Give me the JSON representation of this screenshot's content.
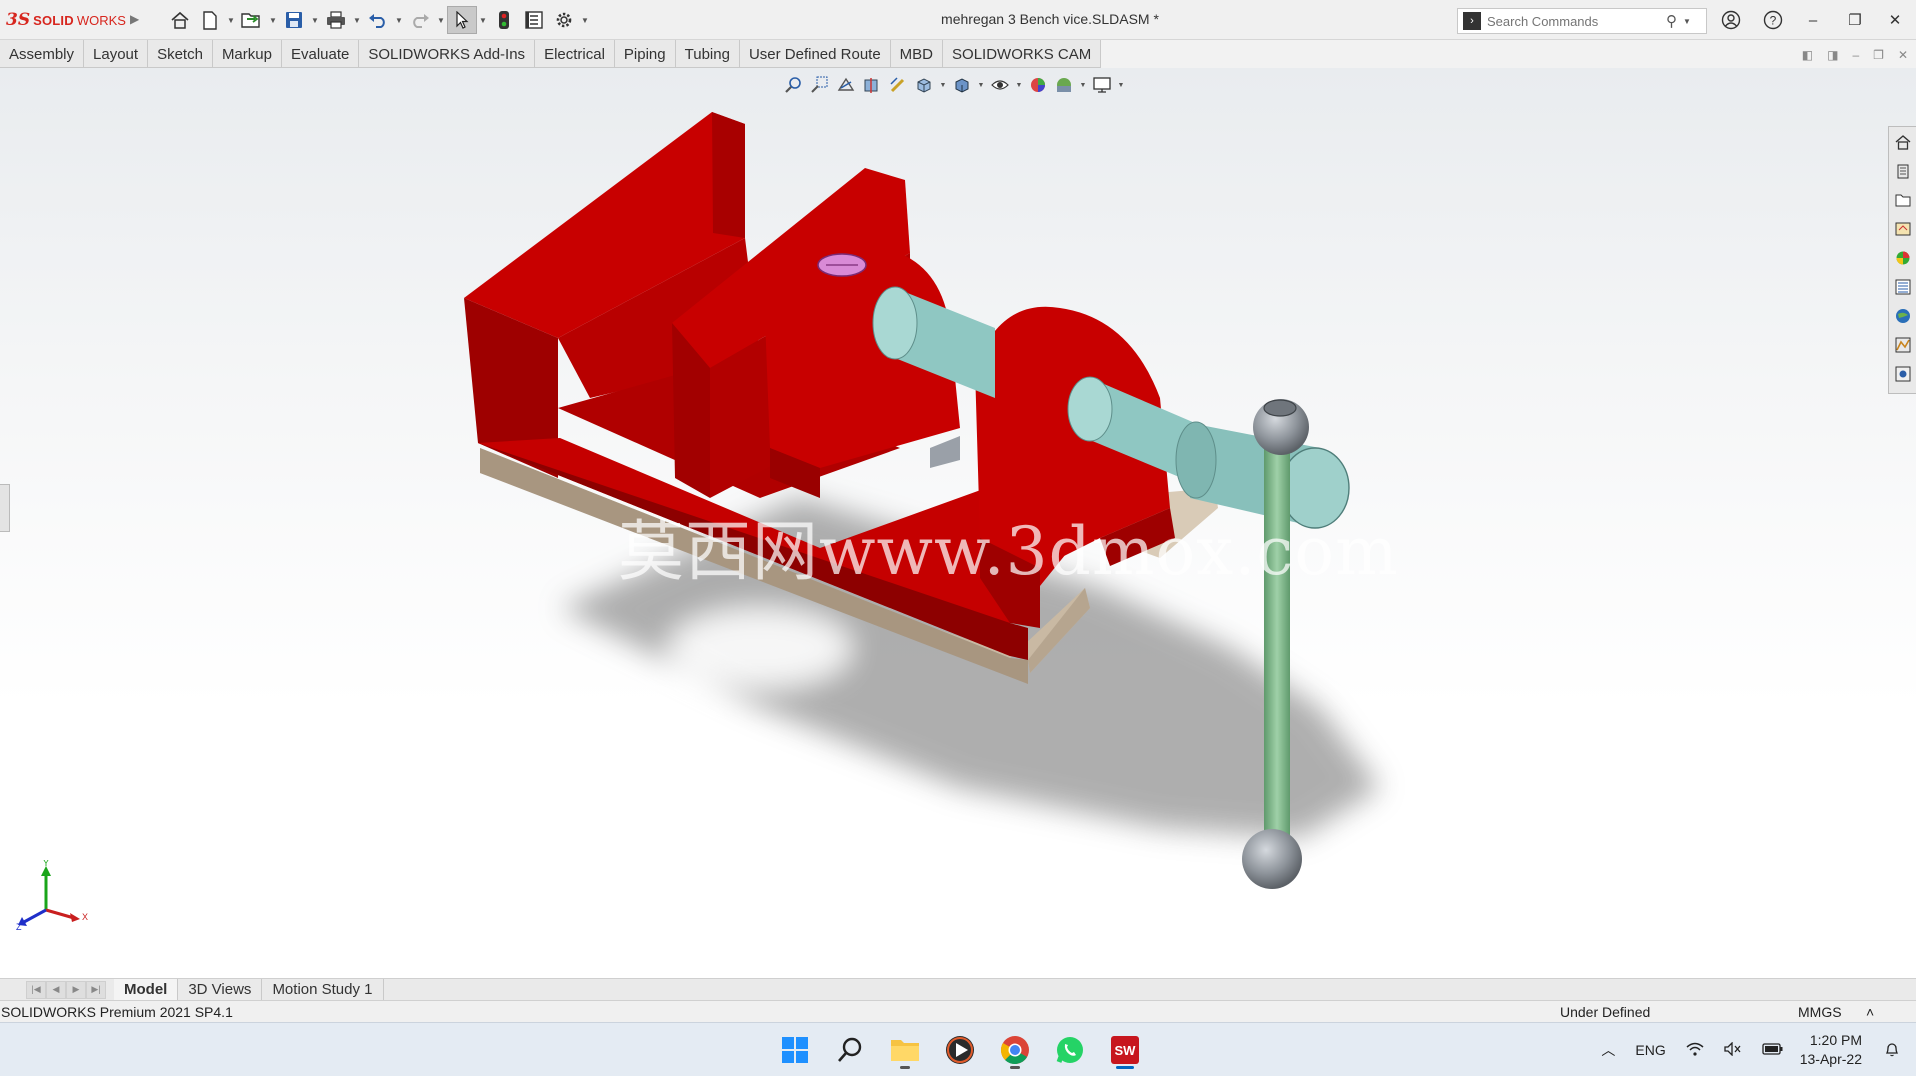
{
  "app": {
    "brand_ds": "3S",
    "brand_solid": "SOLID",
    "brand_works": "WORKS",
    "document_title": "mehregan 3 Bench vice.SLDASM *"
  },
  "search": {
    "placeholder": "Search Commands"
  },
  "command_tabs": [
    "Assembly",
    "Layout",
    "Sketch",
    "Markup",
    "Evaluate",
    "SOLIDWORKS Add-Ins",
    "Electrical",
    "Piping",
    "Tubing",
    "User Defined Route",
    "MBD",
    "SOLIDWORKS CAM"
  ],
  "watermark": "莫西网www.3dmox.com",
  "triad": {
    "x": "X",
    "y": "Y",
    "z": "Z"
  },
  "bottom_tabs": [
    "Model",
    "3D Views",
    "Motion Study 1"
  ],
  "status": {
    "left": "SOLIDWORKS Premium 2021 SP4.1",
    "state": "Under Defined",
    "units": "MMGS",
    "units_arrow": "˄"
  },
  "taskbar": {
    "language": "ENG",
    "time": "1:20 PM",
    "date": "13-Apr-22"
  },
  "colors": {
    "vice_red": "#c80000",
    "screw_teal": "#8fc7c2",
    "handle_green": "#7fb38a",
    "base_tan": "#c9b9a3",
    "brand_red": "#d7261e"
  }
}
